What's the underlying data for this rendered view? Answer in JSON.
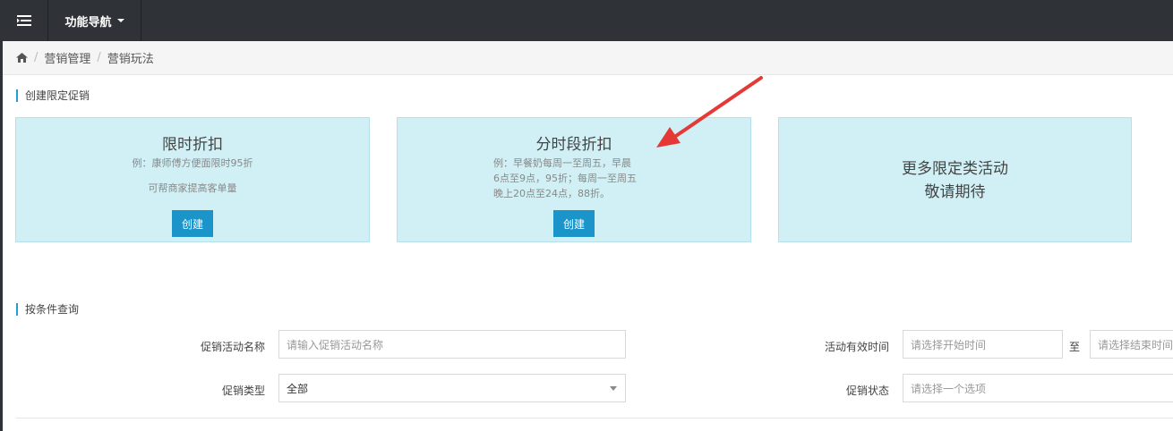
{
  "topbar": {
    "menu_icon": "menu-icon",
    "nav_label": "功能导航"
  },
  "breadcrumb": {
    "home_icon": "home-icon",
    "items": [
      "营销管理",
      "营销玩法"
    ]
  },
  "section_create": {
    "title": "创建限定促销"
  },
  "cards": [
    {
      "title": "限时折扣",
      "desc1": "例：康师傅方便面限时95折",
      "desc2": "可帮商家提高客单量",
      "button": "创建"
    },
    {
      "title": "分时段折扣",
      "desc_lines": [
        "例：早餐奶每周一至周五，早晨",
        "6点至9点，95折；每周一至周五",
        "晚上20点至24点，88折。"
      ],
      "button": "创建"
    },
    {
      "title_lines": [
        "更多限定类活动",
        "敬请期待"
      ]
    }
  ],
  "section_query": {
    "title": "按条件查询"
  },
  "form": {
    "name_label": "促销活动名称",
    "name_placeholder": "请输入促销活动名称",
    "time_label": "活动有效时间",
    "start_placeholder": "请选择开始时间",
    "to_label": "至",
    "end_placeholder": "请选择结束时间",
    "type_label": "促销类型",
    "type_value": "全部",
    "status_label": "促销状态",
    "status_placeholder": "请选择一个选项"
  },
  "colors": {
    "topbar": "#2f3337",
    "card_bg": "#d0f0f6",
    "button": "#1a94c9",
    "accent": "#2b9ad6",
    "annotation_arrow": "#e53935"
  }
}
